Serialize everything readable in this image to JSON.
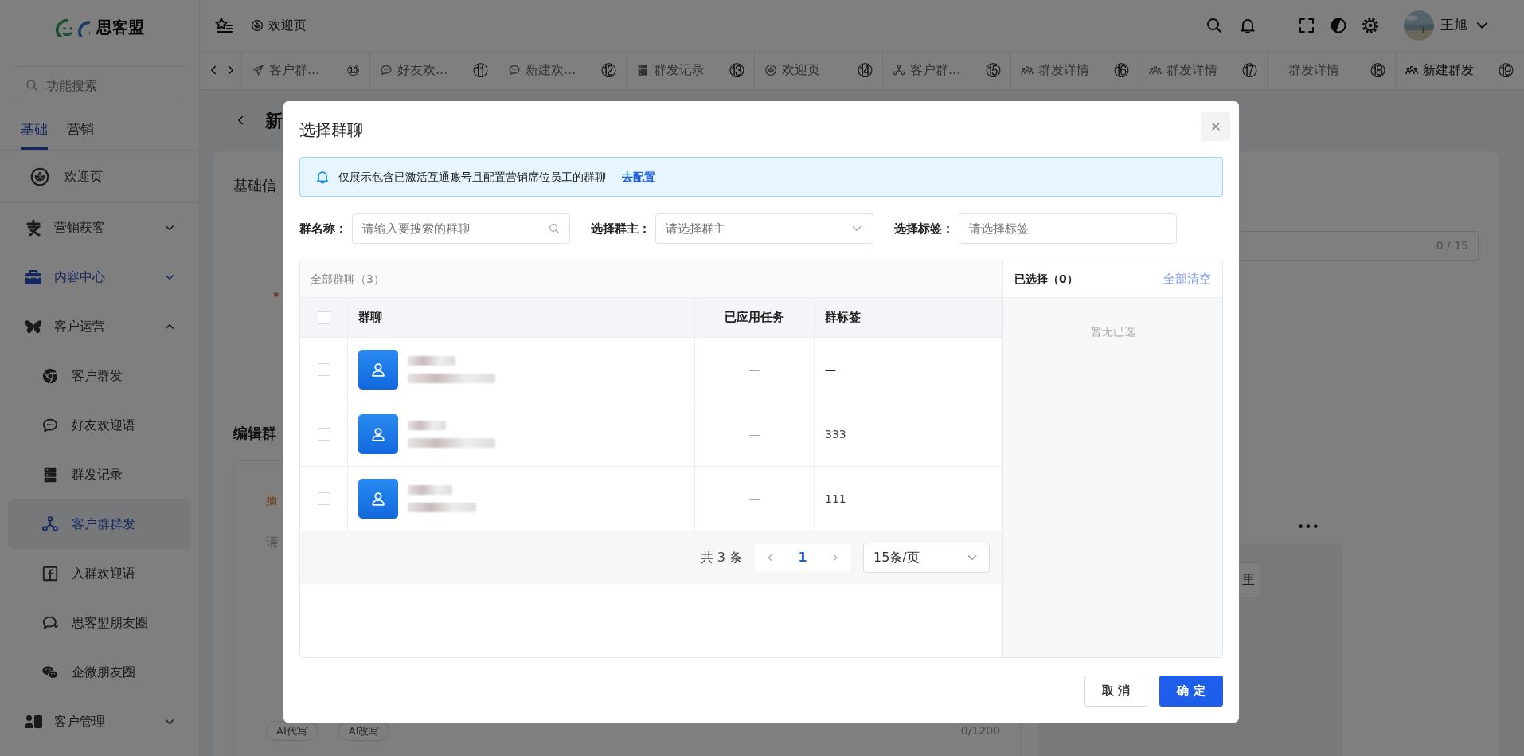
{
  "app": {
    "logo_text": "思客盟",
    "search": {
      "placeholder": "功能搜索"
    },
    "menu_tabs": [
      {
        "label": "基础",
        "selected": true
      },
      {
        "label": "营销",
        "selected": false
      }
    ],
    "menu": [
      {
        "label": "欢迎页",
        "kind": "link",
        "selected": false
      },
      {
        "label": "营销获客",
        "kind": "group",
        "expanded": false,
        "active": false
      },
      {
        "label": "内容中心",
        "kind": "group",
        "expanded": false,
        "active": true
      },
      {
        "label": "客户运营",
        "kind": "group",
        "expanded": true,
        "active": false,
        "children": [
          {
            "label": "客户群发",
            "selected": false
          },
          {
            "label": "好友欢迎语",
            "selected": false
          },
          {
            "label": "群发记录",
            "selected": false
          },
          {
            "label": "客户群群发",
            "selected": true
          },
          {
            "label": "入群欢迎语",
            "selected": false
          },
          {
            "label": "思客盟朋友圈",
            "selected": false
          },
          {
            "label": "企微朋友圈",
            "selected": false
          }
        ]
      },
      {
        "label": "客户管理",
        "kind": "group",
        "expanded": false,
        "active": false
      }
    ]
  },
  "header": {
    "breadcrumb": "欢迎页",
    "user": "王旭"
  },
  "tabs": [
    {
      "label": "客户群...",
      "number": "⑩",
      "selected": false
    },
    {
      "label": "好友欢...",
      "number": "⑪",
      "selected": false
    },
    {
      "label": "新建欢...",
      "number": "⑫",
      "selected": false
    },
    {
      "label": "群发记录",
      "number": "⑬",
      "selected": false
    },
    {
      "label": "欢迎页",
      "number": "⑭",
      "selected": false
    },
    {
      "label": "客户群...",
      "number": "⑮",
      "selected": false
    },
    {
      "label": "群发详情",
      "number": "⑯",
      "selected": false
    },
    {
      "label": "群发详情",
      "number": "⑰",
      "selected": false
    },
    {
      "label": "群发详情",
      "number": "⑱",
      "selected": false
    },
    {
      "label": "新建群发",
      "number": "⑲",
      "selected": true
    }
  ],
  "page": {
    "title": "新",
    "section_1": "基础信",
    "required_mark": "*",
    "counter": "0 / 15",
    "section_2": "编辑群",
    "editor": {
      "insert": "插",
      "placeholder": "请",
      "ai_buttons": [
        "AI代写",
        "AI改写"
      ],
      "counter": "0/1200"
    },
    "preview": {
      "menu": "•••",
      "button": "里"
    }
  },
  "dialog": {
    "title": "选择群聊",
    "notice": {
      "text": "仅展示包含已激活互通账号且配置营销席位员工的群聊",
      "link": "去配置"
    },
    "filters": [
      {
        "label": "群名称：",
        "placeholder": "请输入要搜索的群聊",
        "kind": "search"
      },
      {
        "label": "选择群主：",
        "placeholder": "请选择群主",
        "kind": "select"
      },
      {
        "label": "选择标签：",
        "placeholder": "请选择标签",
        "kind": "input"
      }
    ],
    "list": {
      "title": "全部群聊（3）",
      "columns": [
        "群聊",
        "已应用任务",
        "群标签"
      ],
      "all_checked": false,
      "rows": [
        {
          "checked": false,
          "applied_tasks": "—",
          "tags": "—"
        },
        {
          "checked": false,
          "applied_tasks": "—",
          "tags": "333"
        },
        {
          "checked": false,
          "applied_tasks": "—",
          "tags": "111"
        }
      ],
      "pagination": {
        "total": "共 3 条",
        "pages": [
          {
            "label": "1",
            "selected": true
          }
        ],
        "page_size": "15条/页"
      }
    },
    "selected_panel": {
      "title": "已选择（0）",
      "clear": "全部清空",
      "empty": "暂无已选"
    },
    "buttons": [
      {
        "label": "取 消",
        "kind": "secondary"
      },
      {
        "label": "确 定",
        "kind": "primary"
      }
    ]
  }
}
